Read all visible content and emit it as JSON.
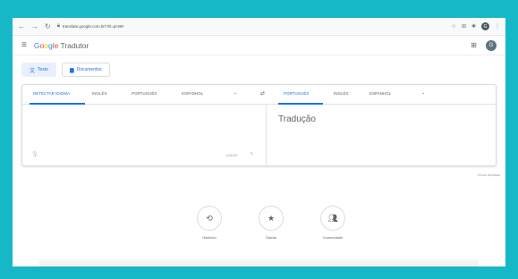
{
  "browser": {
    "url": "translate.google.com.br/?hl=pt-BR",
    "profile_initial": "G"
  },
  "header": {
    "brand": {
      "g1": "G",
      "g2": "o",
      "g3": "o",
      "g4": "g",
      "g5": "l",
      "g6": "e"
    },
    "product": "Tradutor",
    "avatar_initial": "G"
  },
  "modes": [
    {
      "label": "Texto",
      "icon": "translate-icon",
      "active": true
    },
    {
      "label": "Documentos",
      "icon": "document-icon",
      "active": false
    }
  ],
  "source_langs": [
    "DETECTAR IDIOMA",
    "INGLÊS",
    "PORTUGUÊS",
    "ESPANHOL"
  ],
  "target_langs": [
    "PORTUGUÊS",
    "INGLÊS",
    "ESPANHOL"
  ],
  "translator": {
    "target_placeholder": "Tradução",
    "char_count": "0/5000"
  },
  "feedback_label": "Enviar feedback",
  "actions": [
    {
      "label": "Histórico",
      "icon": "history-icon"
    },
    {
      "label": "Salvas",
      "icon": "star-icon"
    },
    {
      "label": "Comunidade",
      "icon": "community-icon"
    }
  ],
  "colors": {
    "accent": "#1a73e8",
    "frame": "#16b8c8"
  }
}
